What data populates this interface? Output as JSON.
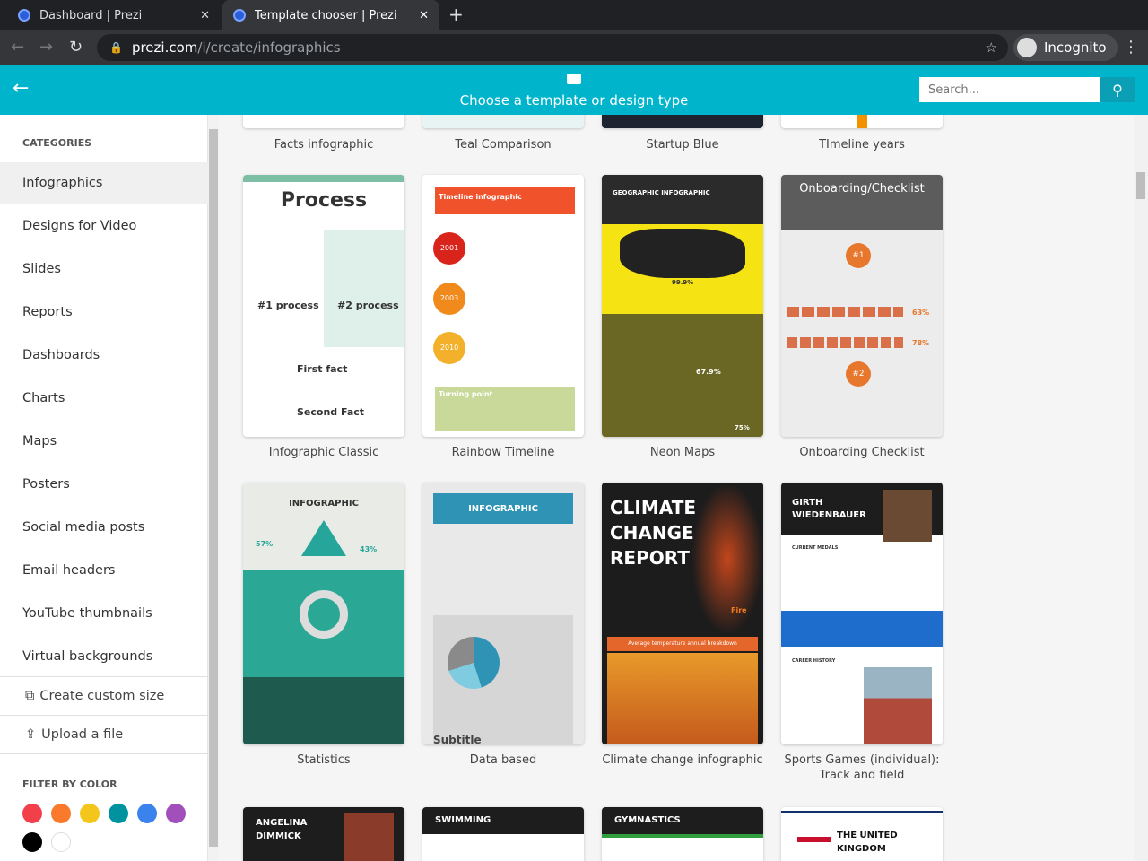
{
  "browser": {
    "tabs": [
      {
        "title": "Dashboard | Prezi"
      },
      {
        "title": "Template chooser | Prezi"
      }
    ],
    "url_host": "prezi.com",
    "url_path": "/i/create/infographics",
    "profile": "Incognito"
  },
  "header": {
    "title": "Choose a template or design type",
    "search_placeholder": "Search..."
  },
  "sidebar": {
    "categories_heading": "CATEGORIES",
    "categories": [
      "Infographics",
      "Designs for Video",
      "Slides",
      "Reports",
      "Dashboards",
      "Charts",
      "Maps",
      "Posters",
      "Social media posts",
      "Email headers",
      "YouTube thumbnails",
      "Virtual backgrounds"
    ],
    "selected": "Infographics",
    "create_custom": "Create custom size",
    "upload": "Upload a file",
    "filter_heading": "FILTER BY COLOR",
    "colors": [
      "#f23f4a",
      "#f97a2b",
      "#f4c51a",
      "#00939f",
      "#3a82ec",
      "#a14fba",
      "#000000",
      "#ffffff"
    ]
  },
  "templates": {
    "row0": [
      "Facts infographic",
      "Teal Comparison",
      "Startup Blue",
      "TImeline years"
    ],
    "row1": [
      {
        "label": "Infographic Classic",
        "thumb": [
          "Process",
          "#1 process",
          "#2 process",
          "First fact",
          "Second Fact"
        ]
      },
      {
        "label": "Rainbow Timeline",
        "thumb": [
          "Timeline infographic",
          "2001",
          "2003",
          "2010",
          "Turning point"
        ]
      },
      {
        "label": "Neon Maps",
        "thumb": [
          "GEOGRAPHIC INFOGRAPHIC",
          "99.9%",
          "67.9%",
          "75%"
        ]
      },
      {
        "label": "Onboarding Checklist",
        "thumb": [
          "Onboarding/Checklist",
          "#1",
          "#2",
          "63%",
          "78%"
        ]
      }
    ],
    "row2": [
      {
        "label": "Statistics",
        "thumb": [
          "INFOGRAPHIC",
          "57%",
          "43%"
        ]
      },
      {
        "label": "Data based",
        "thumb": [
          "INFOGRAPHIC",
          "Subtitle"
        ]
      },
      {
        "label": "Climate change infographic",
        "thumb": [
          "CLIMATE CHANGE REPORT",
          "Fire",
          "Average temperature annual breakdown"
        ]
      },
      {
        "label": "Sports Games (individual): Track and field",
        "thumb": [
          "GIRTH WIEDENBAUER",
          "CURRENT MEDALS",
          "CAREER HISTORY"
        ]
      }
    ],
    "row3": [
      {
        "thumb": "ANGELINA DIMMICK"
      },
      {
        "thumb": "SWIMMING"
      },
      {
        "thumb": "GYMNASTICS"
      },
      {
        "thumb": "THE UNITED KINGDOM"
      }
    ]
  }
}
